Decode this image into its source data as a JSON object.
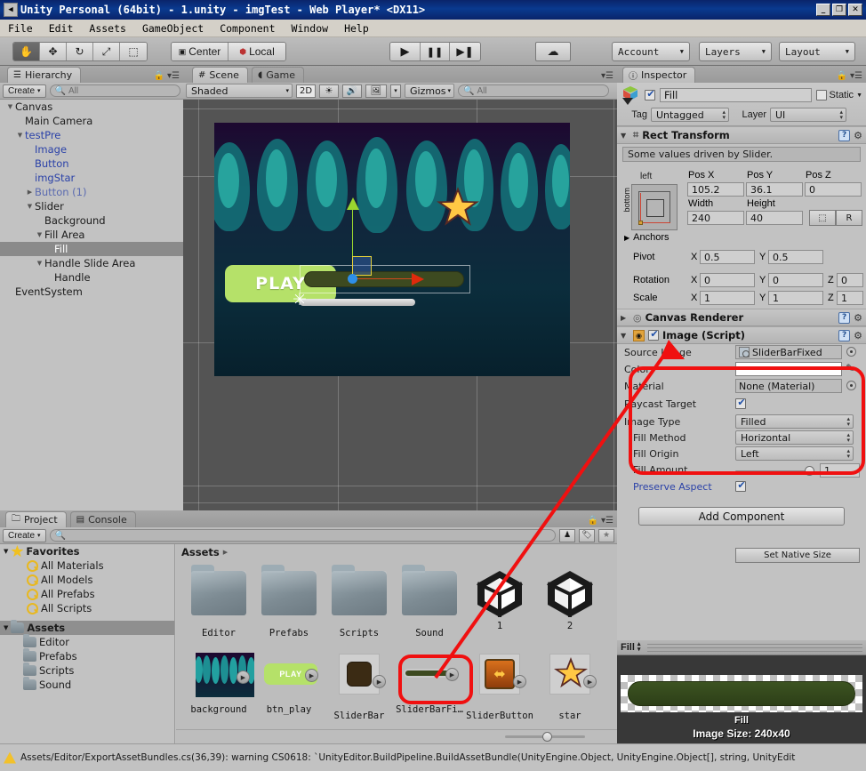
{
  "window": {
    "title": "Unity Personal (64bit) - 1.unity - imgTest - Web Player* <DX11>",
    "sysicon": "unity-icon",
    "minimize": "_",
    "maximize": "❐",
    "close": "✕"
  },
  "menubar": [
    "File",
    "Edit",
    "Assets",
    "GameObject",
    "Component",
    "Window",
    "Help"
  ],
  "toolbar": {
    "tools": [
      "hand-tool",
      "move-tool",
      "rotate-tool",
      "scale-tool",
      "rect-tool"
    ],
    "pivot_mode": "Center",
    "pivot_rotation": "Local",
    "play": "▶",
    "pause": "❚❚",
    "step": "▶❚",
    "cloud": "☁",
    "account": "Account",
    "layers": "Layers",
    "layout": "Layout"
  },
  "hierarchy": {
    "tab": "Hierarchy",
    "create": "Create",
    "search_placeholder": "All",
    "items": [
      {
        "label": "Canvas",
        "indent": 0,
        "fold": "▼",
        "style": "normal"
      },
      {
        "label": "Main Camera",
        "indent": 1,
        "fold": "",
        "style": "normal"
      },
      {
        "label": "testPre",
        "indent": 1,
        "fold": "▼",
        "style": "blue"
      },
      {
        "label": "Image",
        "indent": 2,
        "fold": "",
        "style": "blue"
      },
      {
        "label": "Button",
        "indent": 2,
        "fold": "",
        "style": "blue"
      },
      {
        "label": "imgStar",
        "indent": 2,
        "fold": "",
        "style": "blue"
      },
      {
        "label": "Button (1)",
        "indent": 2,
        "fold": "▶",
        "style": "blue-dim"
      },
      {
        "label": "Slider",
        "indent": 2,
        "fold": "▼",
        "style": "normal"
      },
      {
        "label": "Background",
        "indent": 3,
        "fold": "",
        "style": "normal"
      },
      {
        "label": "Fill Area",
        "indent": 3,
        "fold": "▼",
        "style": "normal"
      },
      {
        "label": "Fill",
        "indent": 4,
        "fold": "",
        "style": "selected"
      },
      {
        "label": "Handle Slide Area",
        "indent": 3,
        "fold": "▼",
        "style": "normal"
      },
      {
        "label": "Handle",
        "indent": 4,
        "fold": "",
        "style": "normal"
      },
      {
        "label": "EventSystem",
        "indent": 0,
        "fold": "",
        "style": "normal"
      }
    ]
  },
  "scene": {
    "tabs": [
      {
        "label": "Scene",
        "icon": "grid-icon",
        "active": true
      },
      {
        "label": "Game",
        "icon": "gamepad-icon",
        "active": false
      }
    ],
    "draw_mode": "Shaded",
    "mode_2d": "2D",
    "lighting_icon": "sun-icon",
    "audio_icon": "speaker-icon",
    "effects_icon": "image-icon",
    "gizmos": "Gizmos",
    "search_placeholder": "All",
    "play_button_label": "PLAY"
  },
  "inspector": {
    "tab": "Inspector",
    "object_name": "Fill",
    "enabled": true,
    "static_label": "Static",
    "static_checked": false,
    "tag_label": "Tag",
    "tag_value": "Untagged",
    "layer_label": "Layer",
    "layer_value": "UI",
    "rect_transform": {
      "title": "Rect Transform",
      "info": "Some values driven by Slider.",
      "anchor_preset_top": "left",
      "anchor_preset_side": "bottom",
      "pos_x_label": "Pos X",
      "pos_y_label": "Pos Y",
      "pos_z_label": "Pos Z",
      "pos_x": "105.2",
      "pos_y": "36.1",
      "pos_z": "0",
      "width_label": "Width",
      "height_label": "Height",
      "width": "240",
      "height": "40",
      "blueprint_btn": "blueprint-icon",
      "raw_btn": "R",
      "anchors_label": "Anchors",
      "pivot_label": "Pivot",
      "pivot_x": "0.5",
      "pivot_y": "0.5",
      "rotation_label": "Rotation",
      "rot_x": "0",
      "rot_y": "0",
      "rot_z": "0",
      "scale_label": "Scale",
      "scale_x": "1",
      "scale_y": "1",
      "scale_z": "1",
      "axis_x": "X",
      "axis_y": "Y",
      "axis_z": "Z"
    },
    "canvas_renderer": {
      "title": "Canvas Renderer"
    },
    "image_script": {
      "title": "Image (Script)",
      "enabled": true,
      "source_image_label": "Source Image",
      "source_image_value": "SliderBarFixed",
      "color_label": "Color",
      "color_value": "#FFFFFF",
      "material_label": "Material",
      "material_value": "None (Material)",
      "raycast_label": "Raycast Target",
      "raycast_checked": true,
      "image_type_label": "Image Type",
      "image_type_value": "Filled",
      "fill_method_label": "Fill Method",
      "fill_method_value": "Horizontal",
      "fill_origin_label": "Fill Origin",
      "fill_origin_value": "Left",
      "fill_amount_label": "Fill Amount",
      "fill_amount_value": "1",
      "preserve_aspect_label": "Preserve Aspect",
      "preserve_aspect_checked": true,
      "set_native_size": "Set Native Size"
    },
    "add_component": "Add Component"
  },
  "preview": {
    "title": "Fill",
    "caption": "Fill",
    "size_text": "Image Size: 240x40"
  },
  "project": {
    "tabs": [
      {
        "label": "Project",
        "icon": "folder-icon",
        "active": true
      },
      {
        "label": "Console",
        "icon": "console-icon",
        "active": false
      }
    ],
    "create": "Create",
    "search_placeholder": "",
    "breadcrumb": "Assets",
    "tree": [
      {
        "label": "Favorites",
        "kind": "favorites-header",
        "indent": 0
      },
      {
        "label": "All Materials",
        "kind": "search",
        "indent": 1
      },
      {
        "label": "All Models",
        "kind": "search",
        "indent": 1
      },
      {
        "label": "All Prefabs",
        "kind": "search",
        "indent": 1
      },
      {
        "label": "All Scripts",
        "kind": "search",
        "indent": 1
      },
      {
        "label": "Assets",
        "kind": "assets-header",
        "indent": 0
      },
      {
        "label": "Editor",
        "kind": "folder",
        "indent": 1
      },
      {
        "label": "Prefabs",
        "kind": "folder",
        "indent": 1
      },
      {
        "label": "Scripts",
        "kind": "folder",
        "indent": 1
      },
      {
        "label": "Sound",
        "kind": "folder",
        "indent": 1
      }
    ],
    "assets": [
      {
        "label": "Editor",
        "kind": "folder"
      },
      {
        "label": "Prefabs",
        "kind": "folder"
      },
      {
        "label": "Scripts",
        "kind": "folder"
      },
      {
        "label": "Sound",
        "kind": "folder"
      },
      {
        "label": "1",
        "kind": "scene"
      },
      {
        "label": "2",
        "kind": "scene"
      },
      {
        "label": "background",
        "kind": "sprite-background"
      },
      {
        "label": "btn_play",
        "kind": "sprite-button"
      },
      {
        "label": "SliderBar",
        "kind": "sprite-sliderbar"
      },
      {
        "label": "SliderBarFi…",
        "kind": "sprite-sliderbarfixed",
        "highlighted": true
      },
      {
        "label": "SliderButton",
        "kind": "sprite-sliderbutton"
      },
      {
        "label": "star",
        "kind": "sprite-star"
      }
    ]
  },
  "statusbar": {
    "icon": "warning-icon",
    "message": "Assets/Editor/ExportAssetBundles.cs(36,39): warning CS0618: `UnityEditor.BuildPipeline.BuildAssetBundle(UnityEngine.Object, UnityEngine.Object[], string, UnityEdit"
  },
  "colors": {
    "title_bar": "#0a246a",
    "panel_bg": "#c2c2c2",
    "annotation_red": "#f01010",
    "link_blue": "#2b42a8",
    "fill_green": "#3d4a20",
    "play_green": "#b5e169"
  }
}
